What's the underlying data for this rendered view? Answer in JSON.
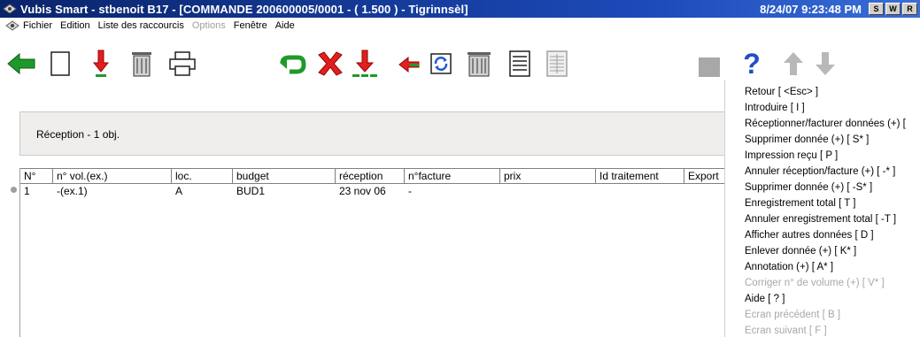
{
  "window": {
    "title": "Vubis Smart - stbenoit B17 - [COMMANDE 200600005/0001 - ( 1.500 ) - Tigrinnsèl]",
    "datetime": "8/24/07 9:23:48 PM",
    "buttons": [
      "S",
      "W",
      "R"
    ]
  },
  "menubar": {
    "items": [
      {
        "label": "Fichier",
        "disabled": false
      },
      {
        "label": "Edition",
        "disabled": false
      },
      {
        "label": "Liste des raccourcis",
        "disabled": false
      },
      {
        "label": "Options",
        "disabled": true
      },
      {
        "label": "Fenêtre",
        "disabled": false
      },
      {
        "label": "Aide",
        "disabled": false
      }
    ]
  },
  "toolbar": {
    "icons": [
      "back-arrow-icon",
      "new-document-icon",
      "receive-arrow-icon",
      "trash-icon",
      "print-icon",
      "undo-icon",
      "delete-x-icon",
      "receive-all-icon",
      "back-small-icon",
      "refresh-icon",
      "trash-all-icon",
      "list-icon",
      "list-grey-icon",
      "grey-block-icon",
      "help-icon",
      "up-arrow-icon",
      "down-arrow-icon"
    ]
  },
  "panel": {
    "count_label": "Réception - 1 obj."
  },
  "table": {
    "columns": [
      "N°",
      "n° vol.(ex.)",
      "loc.",
      "budget",
      "réception",
      "n°facture",
      "prix",
      "Id traitement",
      "Export"
    ],
    "rows": [
      [
        "1",
        "-(ex.1)",
        "A",
        "BUD1",
        "23 nov 06",
        "-",
        "",
        "",
        ""
      ]
    ]
  },
  "popup_menu": {
    "items": [
      {
        "label": "Retour [ <Esc> ]",
        "disabled": false
      },
      {
        "label": "Introduire [ I ]",
        "disabled": false
      },
      {
        "label": "Réceptionner/facturer données (+) [",
        "disabled": false
      },
      {
        "label": "Supprimer donnée (+) [ S* ]",
        "disabled": false
      },
      {
        "label": "Impression reçu [ P ]",
        "disabled": false
      },
      {
        "label": "Annuler réception/facture (+) [ -* ]",
        "disabled": false
      },
      {
        "label": "Supprimer donnée (+) [ -S* ]",
        "disabled": false
      },
      {
        "label": "Enregistrement total [ T ]",
        "disabled": false
      },
      {
        "label": "Annuler enregistrement total [ -T ]",
        "disabled": false
      },
      {
        "label": "Afficher autres données [ D ]",
        "disabled": false
      },
      {
        "label": "Enlever donnée (+) [ K* ]",
        "disabled": false
      },
      {
        "label": "Annotation (+) [ A* ]",
        "disabled": false
      },
      {
        "label": "Corriger n° de volume (+) [ V* ]",
        "disabled": true
      },
      {
        "label": "Aide [ ? ]",
        "disabled": false
      },
      {
        "label": "Ecran précédent [ B ]",
        "disabled": true
      },
      {
        "label": "Ecran suivant [ F ]",
        "disabled": true
      }
    ]
  },
  "colors": {
    "titlebar": "#0a246a",
    "arrow_green": "#1f9a2a",
    "arrow_red": "#e02020",
    "panel_bg": "#efeeec",
    "disabled_text": "#a8a8a8"
  }
}
